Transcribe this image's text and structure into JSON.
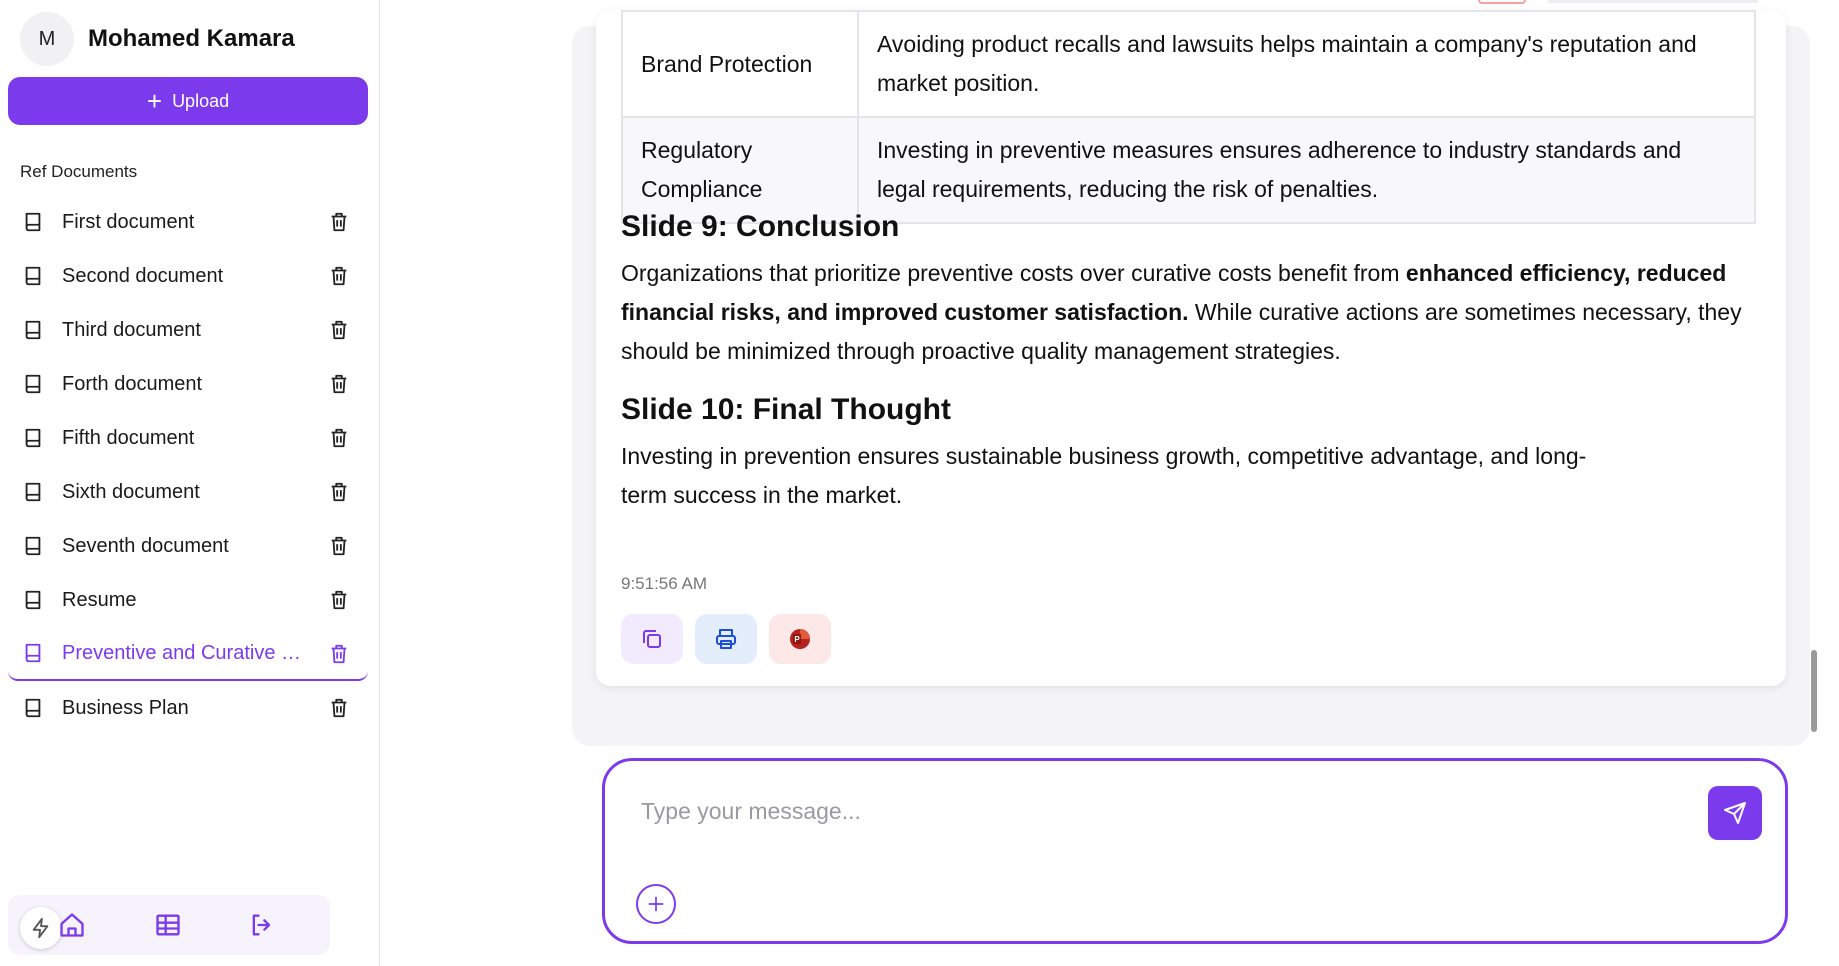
{
  "user": {
    "initial": "M",
    "name": "Mohamed Kamara"
  },
  "sidebar": {
    "upload_label": "Upload",
    "ref_title": "Ref Documents",
    "documents": [
      {
        "label": "First document"
      },
      {
        "label": "Second document"
      },
      {
        "label": "Third document"
      },
      {
        "label": "Forth document"
      },
      {
        "label": "Fifth document"
      },
      {
        "label": "Sixth document"
      },
      {
        "label": "Seventh document"
      },
      {
        "label": "Resume"
      },
      {
        "label": "Preventive and Curative Costs",
        "active": true
      },
      {
        "label": "Business Plan"
      }
    ],
    "nav_icons": [
      "bolt-icon",
      "home-icon",
      "table-icon",
      "logout-icon"
    ]
  },
  "message": {
    "table": [
      {
        "term": "Brand Protection",
        "desc": "Avoiding product recalls and lawsuits helps maintain a company's reputation and market position."
      },
      {
        "term": "Regulatory Compliance",
        "desc": "Investing in preventive measures ensures adherence to industry standards and legal requirements, reducing the risk of penalties."
      }
    ],
    "slide9_title": "Slide 9: Conclusion",
    "slide9_text_1": "Organizations that prioritize preventive costs over curative costs benefit from ",
    "slide9_bold": "enhanced efficiency, reduced financial risks, and improved customer satisfaction.",
    "slide9_text_2": " While curative actions are sometimes necessary, they should be minimized through proactive quality management strategies.",
    "slide10_title": "Slide 10: Final Thought",
    "slide10_text": "Investing in prevention ensures sustainable business growth, competitive advantage, and long-term success in the market.",
    "timestamp": "9:51:56 AM",
    "actions": [
      "copy-icon",
      "print-icon",
      "powerpoint-icon"
    ]
  },
  "composer": {
    "placeholder": "Type your message..."
  },
  "colors": {
    "accent": "#7c3aed",
    "accent_light": "#f1ebfd",
    "blue_light": "#e3edfb",
    "red_light": "#fde8e8",
    "ppt_red": "#b7211f"
  }
}
